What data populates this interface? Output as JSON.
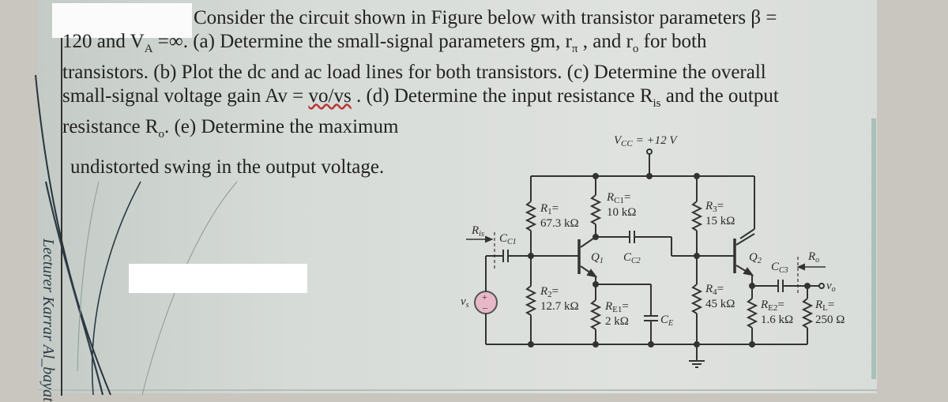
{
  "problem": {
    "line1": "Consider the circuit shown in Figure below with transistor parameters β =",
    "line2": "120 and V",
    "line2_sub": "A",
    "line2_rest": " =∞. (a) Determine the small-signal parameters gm, r",
    "line2_pi": "π",
    "line2_rest2": " , and r",
    "line2_o": "o",
    "line2_end": " for both",
    "line3": "transistors. (b) Plot the dc and ac load lines for both transistors. (c) Determine the overall",
    "line4_a": "small-signal voltage gain Av = ",
    "line4_b": "vo/vs",
    "line4_c": " . (d) Determine the input resistance R",
    "line4_sub": "is",
    "line4_d": " and the output",
    "line5_a": "resistance R",
    "line5_sub": "o",
    "line5_b": ". (e) Determine the maximum",
    "line6": "undistorted swing in the output voltage."
  },
  "caption": "Lecturer Karrar Al_bayat",
  "circuit": {
    "vcc": "V",
    "vcc_sub": "CC",
    "vcc_val": " = +12 V",
    "r1_name": "R",
    "r1_sub": "1",
    "r1_val": "67.3 kΩ",
    "rc1_name": "R",
    "rc1_sub": "C1",
    "rc1_val": "10 kΩ",
    "r3_name": "R",
    "r3_sub": "3",
    "r3_val": "15 kΩ",
    "r2_name": "R",
    "r2_sub": "2",
    "r2_val": "12.7 kΩ",
    "re1_name": "R",
    "re1_sub": "E1",
    "re1_val": "2 kΩ",
    "r4_name": "R",
    "r4_sub": "4",
    "r4_val": "45 kΩ",
    "re2_name": "R",
    "re2_sub": "E2",
    "re2_val": "1.6 kΩ",
    "rl_name": "R",
    "rl_sub": "L",
    "rl_val": "250 Ω",
    "q1": "Q",
    "q1_sub": "1",
    "q2": "Q",
    "q2_sub": "2",
    "cc1": "C",
    "cc1_sub": "C1",
    "cc2": "C",
    "cc2_sub": "C2",
    "cc3": "C",
    "cc3_sub": "C3",
    "ce": "C",
    "ce_sub": "E",
    "ris": "R",
    "ris_sub": "is",
    "ro": "R",
    "ro_sub": "o",
    "vs": "v",
    "vs_sub": "s",
    "vo": "v",
    "vo_sub": "o",
    "eq": "="
  }
}
